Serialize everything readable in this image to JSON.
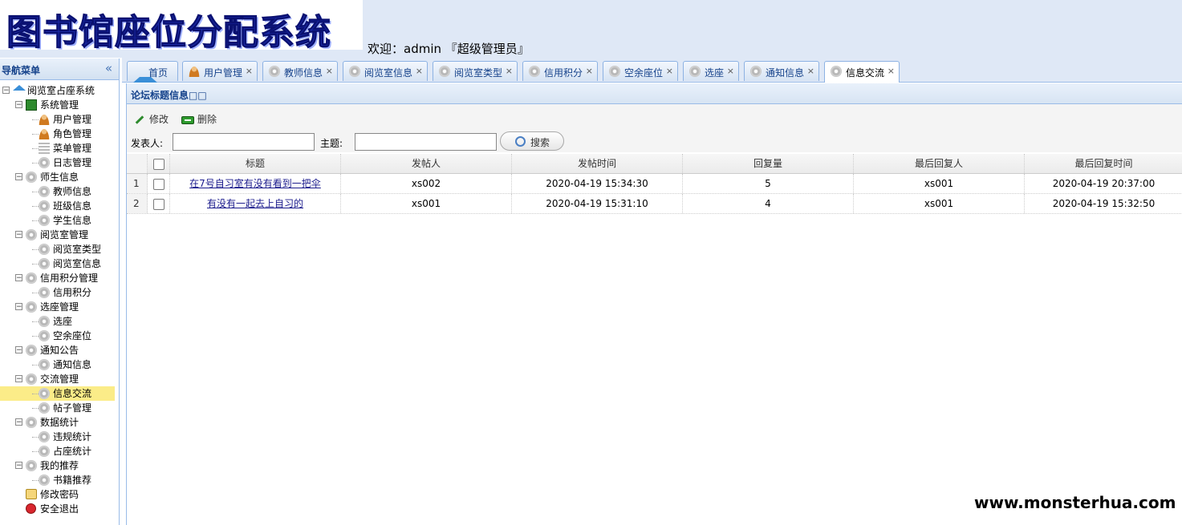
{
  "app": {
    "logo_text": "图书馆座位分配系统",
    "welcome": "欢迎：admin 『超级管理员』"
  },
  "nav": {
    "title": "导航菜单",
    "collapse_glyph": "«",
    "items": [
      {
        "label": "阅览室占座系统",
        "level": 0,
        "icon": "home-icon",
        "toggle": "⊟"
      },
      {
        "label": "系统管理",
        "level": 1,
        "icon": "system-icon",
        "toggle": "⊟"
      },
      {
        "label": "用户管理",
        "level": 2,
        "icon": "user-icon"
      },
      {
        "label": "角色管理",
        "level": 2,
        "icon": "role-icon"
      },
      {
        "label": "菜单管理",
        "level": 2,
        "icon": "menu-icon"
      },
      {
        "label": "日志管理",
        "level": 2,
        "icon": "gear-icon"
      },
      {
        "label": "师生信息",
        "level": 1,
        "icon": "gear-icon",
        "toggle": "⊟"
      },
      {
        "label": "教师信息",
        "level": 2,
        "icon": "gear-icon"
      },
      {
        "label": "班级信息",
        "level": 2,
        "icon": "gear-icon"
      },
      {
        "label": "学生信息",
        "level": 2,
        "icon": "gear-icon"
      },
      {
        "label": "阅览室管理",
        "level": 1,
        "icon": "gear-icon",
        "toggle": "⊟"
      },
      {
        "label": "阅览室类型",
        "level": 2,
        "icon": "gear-icon"
      },
      {
        "label": "阅览室信息",
        "level": 2,
        "icon": "gear-icon"
      },
      {
        "label": "信用积分管理",
        "level": 1,
        "icon": "gear-icon",
        "toggle": "⊟"
      },
      {
        "label": "信用积分",
        "level": 2,
        "icon": "gear-icon"
      },
      {
        "label": "选座管理",
        "level": 1,
        "icon": "gear-icon",
        "toggle": "⊟"
      },
      {
        "label": "选座",
        "level": 2,
        "icon": "gear-icon"
      },
      {
        "label": "空余座位",
        "level": 2,
        "icon": "gear-icon"
      },
      {
        "label": "通知公告",
        "level": 1,
        "icon": "gear-icon",
        "toggle": "⊟"
      },
      {
        "label": "通知信息",
        "level": 2,
        "icon": "gear-icon"
      },
      {
        "label": "交流管理",
        "level": 1,
        "icon": "gear-icon",
        "toggle": "⊟"
      },
      {
        "label": "信息交流",
        "level": 2,
        "icon": "gear-icon",
        "selected": true
      },
      {
        "label": "帖子管理",
        "level": 2,
        "icon": "gear-icon"
      },
      {
        "label": "数据统计",
        "level": 1,
        "icon": "gear-icon",
        "toggle": "⊟"
      },
      {
        "label": "违规统计",
        "level": 2,
        "icon": "gear-icon"
      },
      {
        "label": "占座统计",
        "level": 2,
        "icon": "gear-icon"
      },
      {
        "label": "我的推荐",
        "level": 1,
        "icon": "gear-icon",
        "toggle": "⊟"
      },
      {
        "label": "书籍推荐",
        "level": 2,
        "icon": "gear-icon"
      },
      {
        "label": "修改密码",
        "level": 1,
        "icon": "lock-icon"
      },
      {
        "label": "安全退出",
        "level": 1,
        "icon": "exit-icon"
      }
    ]
  },
  "tabs": [
    {
      "label": "首页",
      "icon": "home-icon",
      "closable": false
    },
    {
      "label": "用户管理",
      "icon": "user-icon",
      "closable": true
    },
    {
      "label": "教师信息",
      "icon": "gear-icon",
      "closable": true
    },
    {
      "label": "阅览室信息",
      "icon": "gear-icon",
      "closable": true
    },
    {
      "label": "阅览室类型",
      "icon": "gear-icon",
      "closable": true
    },
    {
      "label": "信用积分",
      "icon": "gear-icon",
      "closable": true
    },
    {
      "label": "空余座位",
      "icon": "gear-icon",
      "closable": true
    },
    {
      "label": "选座",
      "icon": "gear-icon",
      "closable": true
    },
    {
      "label": "通知信息",
      "icon": "gear-icon",
      "closable": true
    },
    {
      "label": "信息交流",
      "icon": "gear-icon",
      "closable": true,
      "active": true
    }
  ],
  "tab_close_glyph": "×",
  "panel": {
    "title": "论坛标题信息□□",
    "edit_label": "修改",
    "delete_label": "删除",
    "poster_label": "发表人:",
    "poster_value": "",
    "topic_label": "主题:",
    "topic_value": "",
    "search_label": "搜索"
  },
  "table": {
    "columns": [
      "标题",
      "发帖人",
      "发帖时间",
      "回复量",
      "最后回复人",
      "最后回复时间"
    ],
    "rows": [
      {
        "num": "1",
        "title": "在7号自习室有没有看到一把伞",
        "poster": "xs002",
        "post_time": "2020-04-19 15:34:30",
        "replies": "5",
        "last_replier": "xs001",
        "last_reply_time": "2020-04-19 20:37:00"
      },
      {
        "num": "2",
        "title": "有没有一起去上自习的",
        "poster": "xs001",
        "post_time": "2020-04-19 15:31:10",
        "replies": "4",
        "last_replier": "xs001",
        "last_reply_time": "2020-04-19 15:32:50"
      }
    ]
  },
  "watermark": "www.monsterhua.com"
}
